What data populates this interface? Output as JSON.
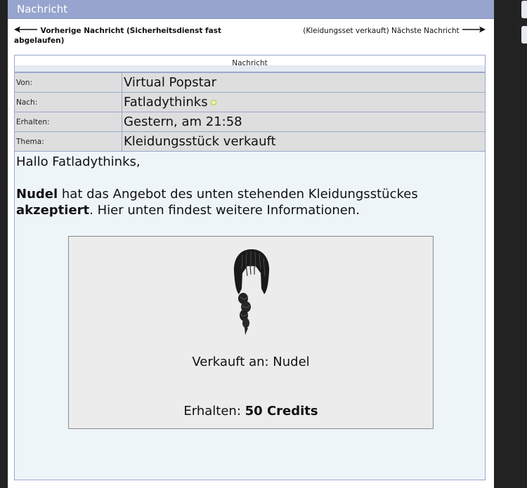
{
  "window": {
    "title": "Nachricht"
  },
  "navigation": {
    "previous": {
      "label": "Vorherige Nachricht (Sicherheitsdienst fast abgelaufen)"
    },
    "next": {
      "label": "(Kleidungsset verkauft) Nächste Nachricht"
    }
  },
  "message": {
    "header": "Nachricht",
    "fields": [
      {
        "key": "Von:",
        "value": "Virtual Popstar"
      },
      {
        "key": "Nach:",
        "value": "Fatladythinks",
        "status": "online"
      },
      {
        "key": "Erhalten:",
        "value": "Gestern, am 21:58"
      },
      {
        "key": "Thema:",
        "value": "Kleidungsstück verkauft"
      }
    ],
    "greeting": "Hallo Fatladythinks,",
    "buyer": "Nudel",
    "text_part1": " hat das Angebot des unten stehenden Kleidungsstückes ",
    "accepted": "akzeptiert",
    "text_part2": ". Hier unten findest weitere Informationen."
  },
  "item": {
    "image": "braided-hair-item",
    "sold_to": "Verkauft an: Nudel",
    "received_label": "Erhalten: ",
    "received_value": "50 Credits"
  },
  "icons": {
    "previous": "arrow-left-icon",
    "next": "arrow-right-icon",
    "status": "online-status-dot"
  },
  "colors": {
    "titlebar": "#97a4cd",
    "border": "#9aa7cc",
    "background": "#eef5f9",
    "online": "#a6cf3b"
  }
}
